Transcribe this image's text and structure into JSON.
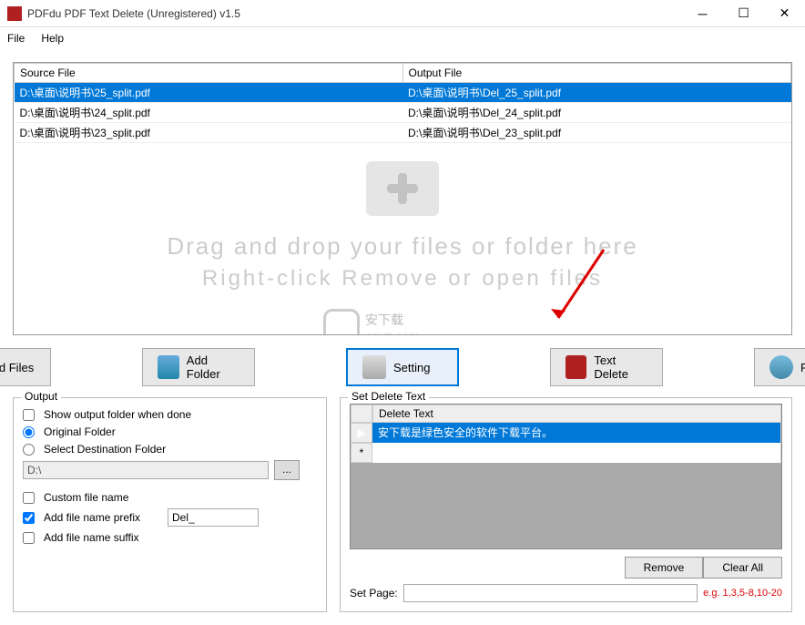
{
  "window": {
    "title": "PDFdu PDF Text Delete (Unregistered) v1.5"
  },
  "menu": {
    "file": "File",
    "help": "Help"
  },
  "table": {
    "headers": {
      "source": "Source File",
      "output": "Output File"
    },
    "rows": [
      {
        "source": "D:\\桌面\\说明书\\25_split.pdf",
        "output": "D:\\桌面\\说明书\\Del_25_split.pdf",
        "selected": true
      },
      {
        "source": "D:\\桌面\\说明书\\24_split.pdf",
        "output": "D:\\桌面\\说明书\\Del_24_split.pdf",
        "selected": false
      },
      {
        "source": "D:\\桌面\\说明书\\23_split.pdf",
        "output": "D:\\桌面\\说明书\\Del_23_split.pdf",
        "selected": false
      }
    ]
  },
  "drop": {
    "line1": "Drag and drop your files or folder here",
    "line2": "Right-click Remove or open files"
  },
  "watermark": {
    "brand": "安下载",
    "domain": "anxz.com"
  },
  "buttons": {
    "addFiles": "Add Files",
    "addFolder": "Add Folder",
    "setting": "Setting",
    "textDelete": "Text Delete",
    "register": "Register"
  },
  "output": {
    "legend": "Output",
    "showFolder": "Show output folder when done",
    "original": "Original Folder",
    "destination": "Select Destination Folder",
    "path": "D:\\",
    "customName": "Custom file name",
    "prefix": "Add file name prefix",
    "prefixVal": "Del_",
    "suffix": "Add file name suffix"
  },
  "delete": {
    "legend": "Set Delete Text",
    "header": "Delete Text",
    "rows": [
      {
        "marker": "▶",
        "text": "安下载是绿色安全的软件下载平台。",
        "selected": true
      },
      {
        "marker": "*",
        "text": "",
        "selected": false
      }
    ],
    "remove": "Remove",
    "clearAll": "Clear All",
    "setPage": "Set Page:",
    "eg": "e.g. 1,3,5-8,10-20"
  }
}
